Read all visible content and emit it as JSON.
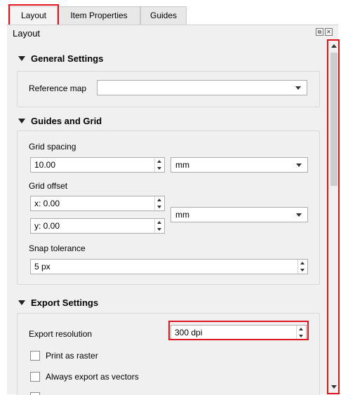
{
  "tabs": [
    {
      "label": "Layout",
      "active": true
    },
    {
      "label": "Item Properties",
      "active": false
    },
    {
      "label": "Guides",
      "active": false
    }
  ],
  "panel": {
    "title": "Layout",
    "float_icon": "float-icon",
    "close_icon": "close-icon"
  },
  "general_settings": {
    "header": "General Settings",
    "reference_map_label": "Reference map",
    "reference_map_value": ""
  },
  "guides_and_grid": {
    "header": "Guides and Grid",
    "grid_spacing_label": "Grid spacing",
    "grid_spacing_value": "10.00",
    "grid_spacing_unit": "mm",
    "grid_offset_label": "Grid offset",
    "grid_offset_x": "x: 0.00",
    "grid_offset_y": "y: 0.00",
    "grid_offset_unit": "mm",
    "snap_tolerance_label": "Snap tolerance",
    "snap_tolerance_value": "5 px"
  },
  "export_settings": {
    "header": "Export Settings",
    "export_resolution_label": "Export resolution",
    "export_resolution_value": "300 dpi",
    "print_as_raster_label": "Print as raster",
    "print_as_raster_checked": false,
    "always_export_vectors_label": "Always export as vectors",
    "always_export_vectors_checked": false
  },
  "annotation_color": "#e0141e"
}
